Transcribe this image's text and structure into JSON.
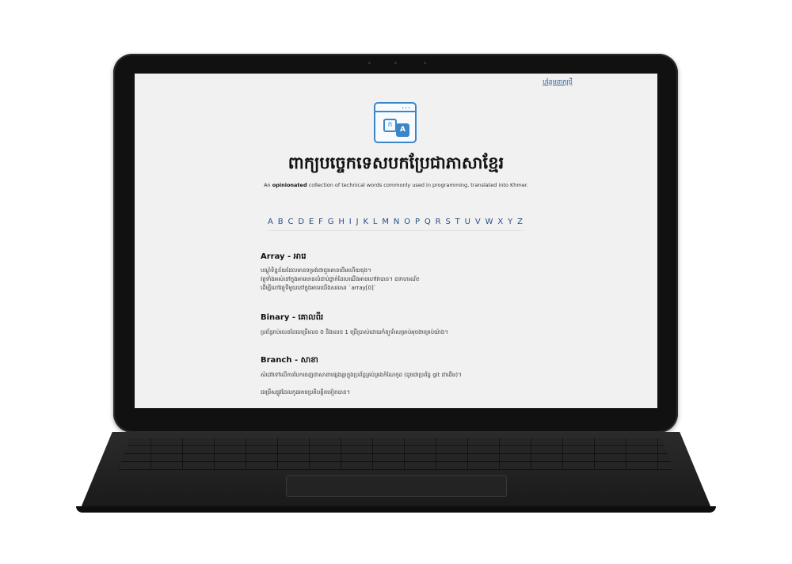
{
  "page": {
    "top_link": "បន្ថែមពាក្យថ្មី",
    "logo_letters": {
      "khmer": "ក",
      "latin": "A"
    },
    "logo_dots": "•••",
    "title": "ពាក្យបច្ចេកទេសបកប្រែជាភាសាខ្មែរ",
    "subtitle_prefix": "An ",
    "subtitle_bold": "opinionated",
    "subtitle_suffix": " collection of technical words commonly used in programming, translated into Khmer.",
    "alphabet": [
      "A",
      "B",
      "C",
      "D",
      "E",
      "F",
      "G",
      "H",
      "I",
      "J",
      "K",
      "L",
      "M",
      "N",
      "O",
      "P",
      "Q",
      "R",
      "S",
      "T",
      "U",
      "V",
      "W",
      "X",
      "Y",
      "Z"
    ]
  },
  "entries": [
    {
      "title": "Array - អារេ",
      "text": "បណ្តុំទិន្នន័យដែលមានទម្រង់ជាជួរគោនជើមហើយចុង។\nវត្ថុទាំងអស់នៅក្នុងអារេមានលំដាប់ថ្នាក់ដែលយើងអាចហៅវាបាន។ ឧទាហរណ៍៖\nដើម្បីហៅវត្ថុទីមួយនៅក្នុងអារេយើងសរសេរ `array[0]`"
    },
    {
      "title": "Binary - គោលពីរ",
      "text": "ប្រព័ន្ធរាប់លេខដែលប្រើលេខ 0 និងលេខ 1 ប្រើប្រាស់ដោយកំព្យូទ័រសម្រាប់អុចងារគ្រប់យ៉ាង។"
    },
    {
      "title": "Branch - សាខា",
      "text": "សំដៅទៅលើការបែកចេញជាសាខាផ្សេងគ្នាក្នុងប្រព័ន្ធគ្រប់គ្រងកំណែកូដ (ដូចជាប្រព័ន្ធ git ជាដើម)។",
      "text2": "ជម្រើសផ្លូវដែលកូដអាចប្រតិបត្តិតទៀតបាន។"
    }
  ]
}
